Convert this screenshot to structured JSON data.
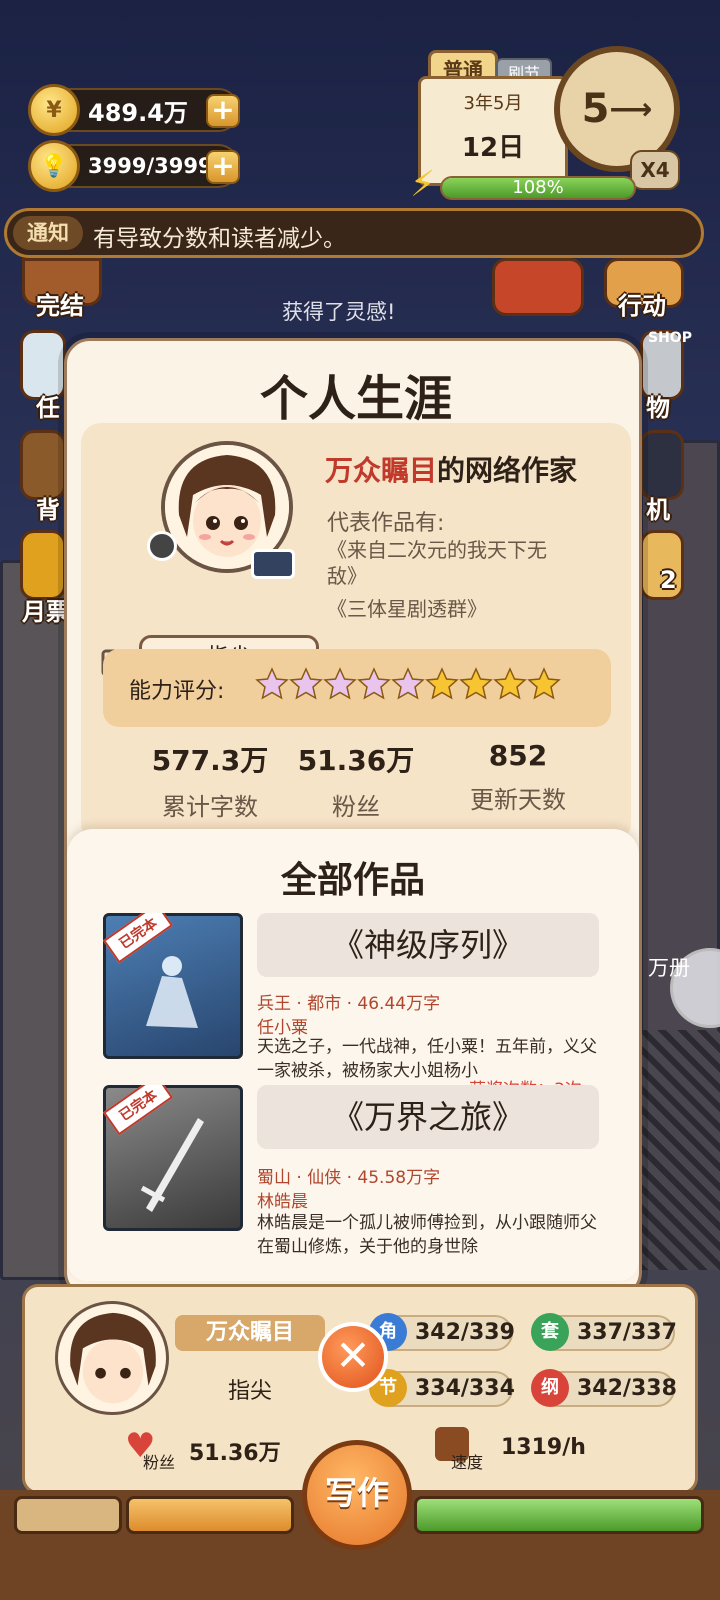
{
  "hud": {
    "coins": "489.4万",
    "energy": "3999/3999",
    "difficulty_tag": "普通",
    "difficulty_tag2": "刷节",
    "date_month": "3年5月",
    "date_day": "12日",
    "progress_text": "108%",
    "dial_value": "5",
    "multiplier": "X4"
  },
  "notice": {
    "tag": "通知",
    "text": "有导致分数和读者减少。"
  },
  "side_menu": {
    "left": [
      "完结",
      "任",
      "背",
      "月票"
    ],
    "right": [
      "行动",
      "物",
      "机",
      "2"
    ],
    "shop": "SHOP",
    "toast": "获得了灵感!"
  },
  "modal": {
    "title": "个人生涯",
    "reputation": "万众瞩目",
    "profession": "的网络作家",
    "rep_works_label": "代表作品有:",
    "rep_works": [
      "《来自二次元的我天下无敌》",
      "《三体星剧透群》"
    ],
    "pen_name": "指尖",
    "rating_label": "能力评分:",
    "rating_stars": 9,
    "stats": [
      {
        "value": "577.3万",
        "label": "累计字数"
      },
      {
        "value": "51.36万",
        "label": "粉丝"
      },
      {
        "value": "852",
        "label": "更新天数"
      }
    ],
    "works_title": "全部作品",
    "works": [
      {
        "badge": "已完本",
        "title": "《神级序列》",
        "meta": "兵王 · 都市 · 46.44万字",
        "protagonist": "任小粟",
        "desc": "天选之子，一代战神，任小粟！五年前，义父一家被杀，被杨家大小姐杨小",
        "award": "获奖次数：3次"
      },
      {
        "badge": "已完本",
        "title": "《万界之旅》",
        "meta": "蜀山 · 仙侠 · 45.58万字",
        "protagonist": "林皓晨",
        "desc": "林皓晨是一个孤儿被师傅捡到，从小跟随师父在蜀山修炼，关于他的身世除"
      }
    ]
  },
  "bottom": {
    "name": "万众瞩目",
    "pen_name": "指尖",
    "stats": [
      {
        "badge": "角",
        "value": "342/339",
        "color": "#3a7bd5"
      },
      {
        "badge": "套",
        "value": "337/337",
        "color": "#3aa35a"
      },
      {
        "badge": "节",
        "value": "334/334",
        "color": "#e0a21e"
      },
      {
        "badge": "纲",
        "value": "342/338",
        "color": "#d9443a"
      }
    ],
    "fans_label": "粉丝",
    "fans_value": "51.36万",
    "speed_label": "速度",
    "speed_value": "1319/h",
    "write_label": "写作",
    "side_text": "万册"
  }
}
